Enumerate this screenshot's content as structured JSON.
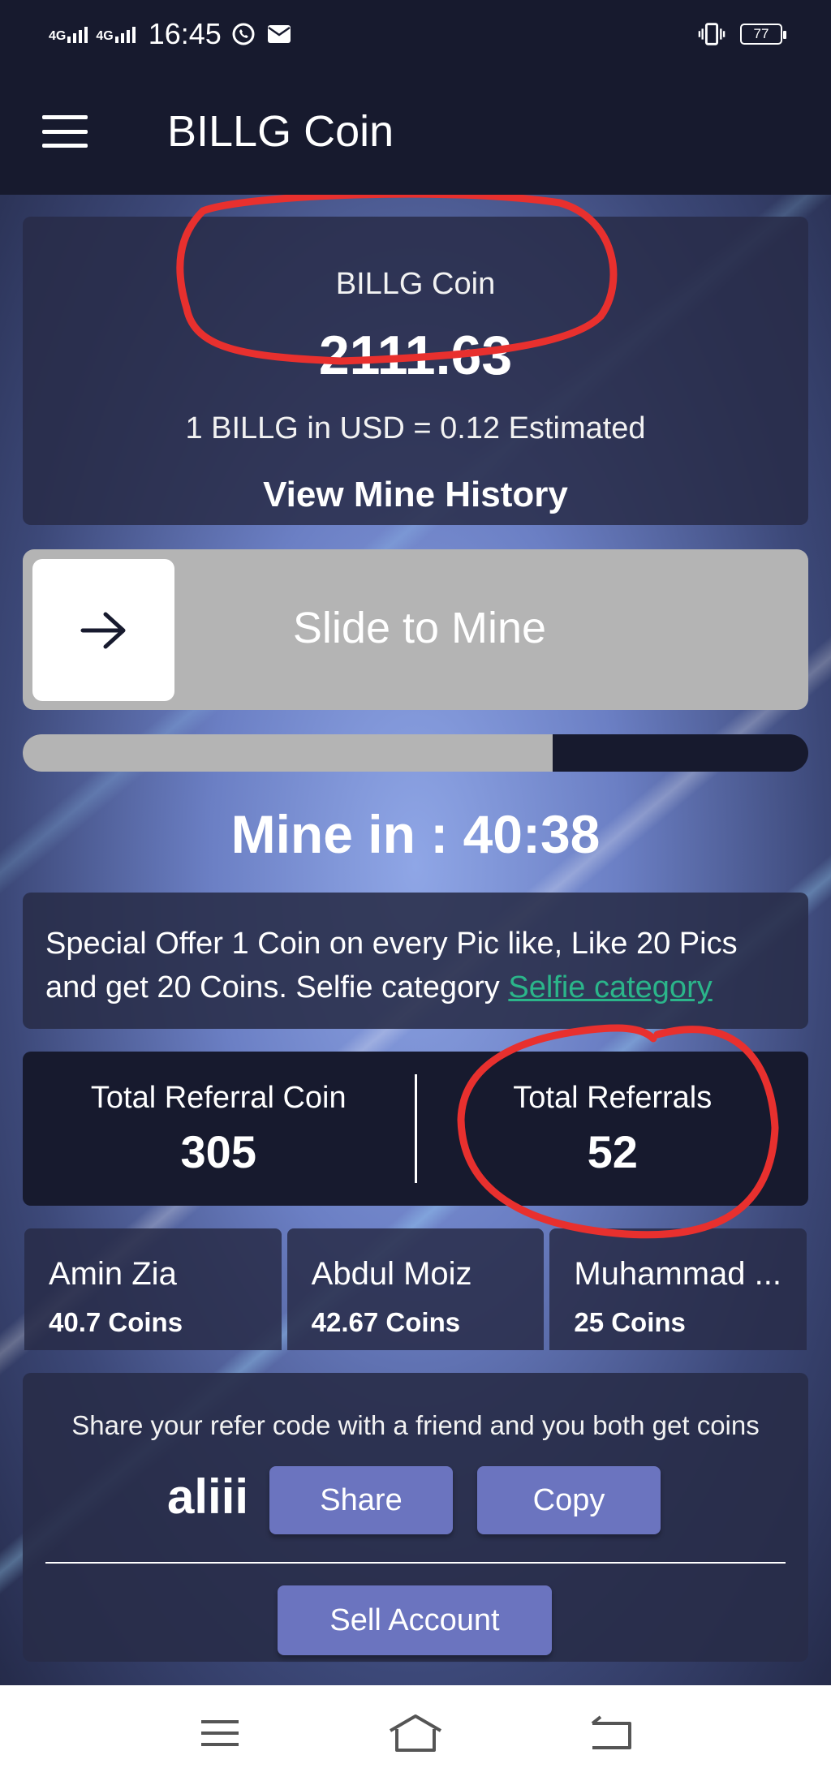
{
  "status_bar": {
    "network_1": "4G",
    "network_2": "4G",
    "time": "16:45",
    "battery": "77",
    "icons": [
      "whatsapp-icon",
      "mail-icon",
      "vibrate-icon",
      "battery-icon"
    ]
  },
  "app_bar": {
    "title": "BILLG Coin",
    "menu_icon": "hamburger-icon"
  },
  "coin_card": {
    "name": "BILLG Coin",
    "balance": "2111.63",
    "rate": "1 BILLG in USD = 0.12 Estimated",
    "history_link": "View Mine History"
  },
  "slider": {
    "label": "Slide to Mine",
    "knob_icon": "arrow-right-icon"
  },
  "progress": {
    "fraction": 0.675
  },
  "mine_timer": "Mine in : 40:38",
  "offer": {
    "text": "Special Offer 1 Coin on every Pic like, Like 20 Pics and get 20 Coins. Selfie category ",
    "link": "Selfie category"
  },
  "stats": {
    "referral_coin_label": "Total Referral Coin",
    "referral_coin_value": "305",
    "referrals_label": "Total Referrals",
    "referrals_value": "52"
  },
  "referrals": [
    {
      "name": "Amin Zia",
      "coins": "40.7 Coins"
    },
    {
      "name": "Abdul Moiz",
      "coins": "42.67 Coins"
    },
    {
      "name": "Muhammad ...",
      "coins": "25 Coins"
    }
  ],
  "share": {
    "text": "Share your refer code with a friend and you both get coins",
    "code": "aliii",
    "share_label": "Share",
    "copy_label": "Copy",
    "sell_label": "Sell Account"
  },
  "nav_bar": {
    "icons": [
      "menu-icon",
      "home-icon",
      "back-icon"
    ]
  },
  "colors": {
    "header": "#171a2e",
    "button": "#6b74bf",
    "link": "#2bb58a",
    "annotation": "#e8302e"
  }
}
